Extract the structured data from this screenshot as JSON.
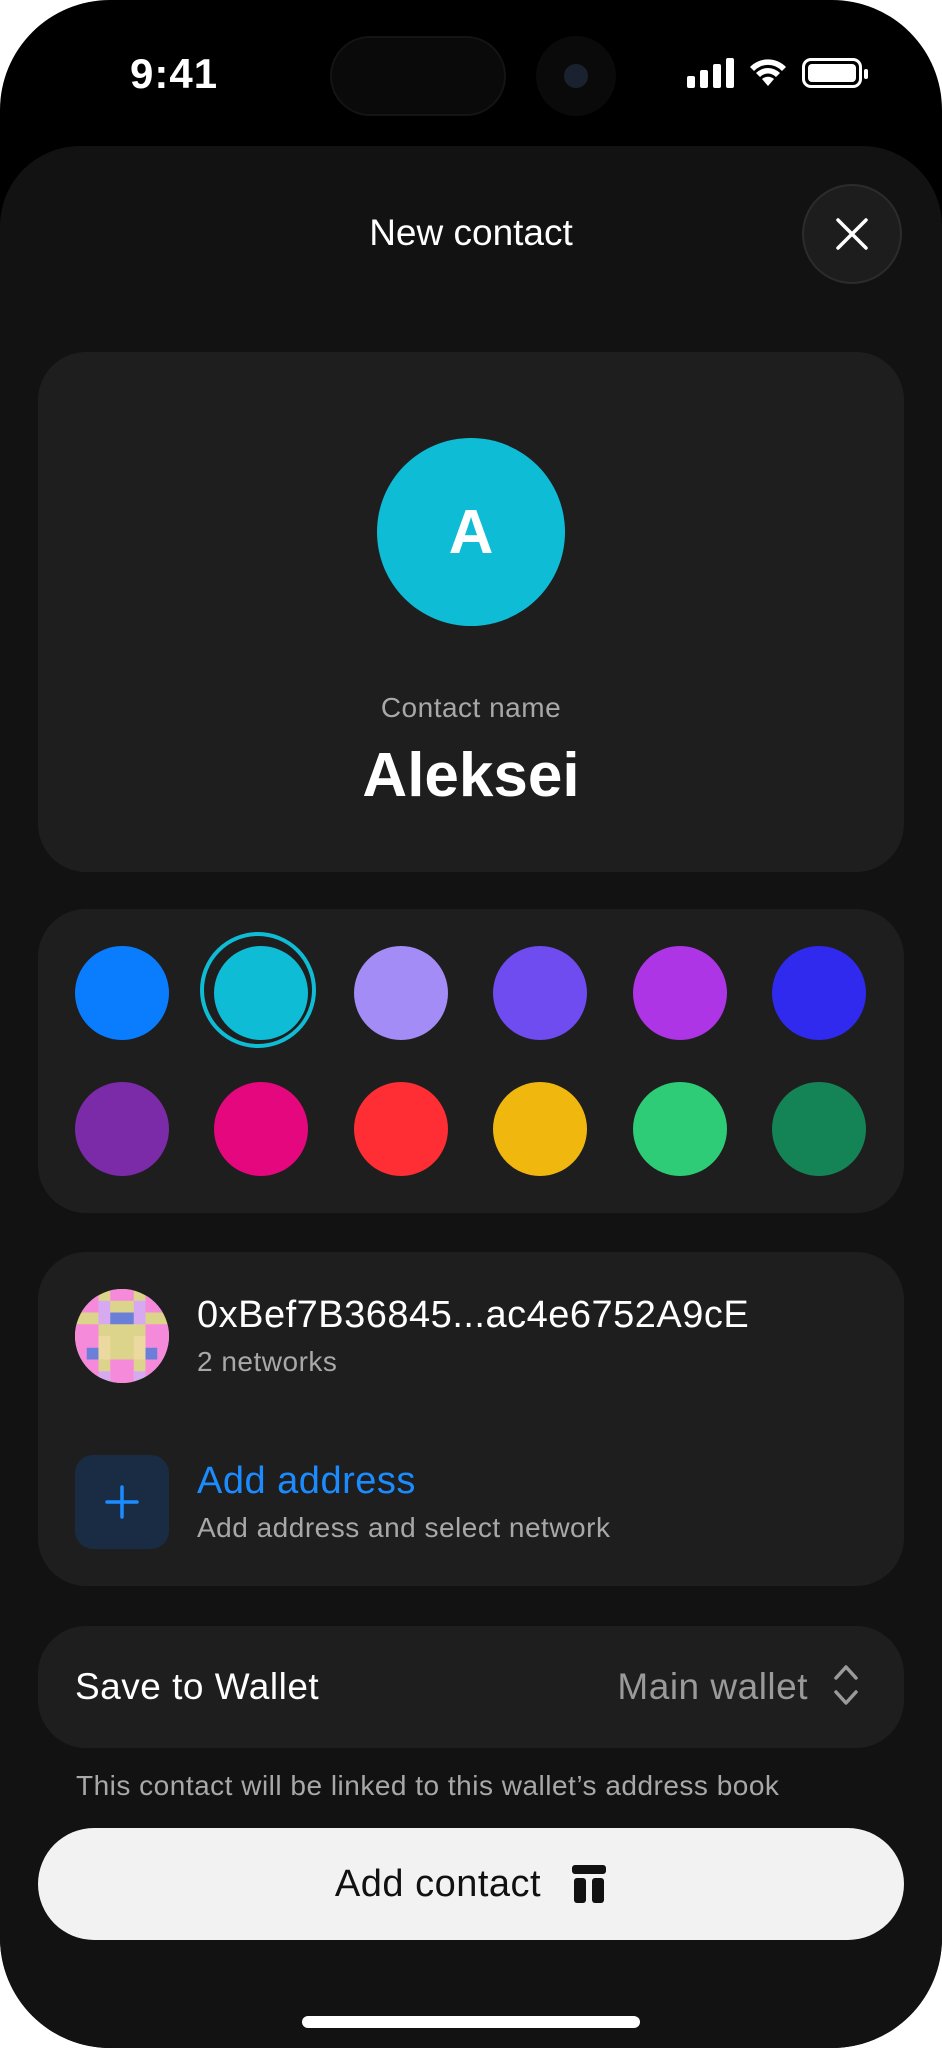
{
  "status_bar": {
    "time": "9:41"
  },
  "sheet": {
    "title": "New contact"
  },
  "profile": {
    "avatar_initial": "A",
    "avatar_color": "#0fbcd6",
    "name_label": "Contact name",
    "name_value": "Aleksei"
  },
  "color_picker": {
    "selected_index": 1,
    "colors": [
      "#0a7dff",
      "#0fbcd6",
      "#a38cf5",
      "#6e4cf0",
      "#ad35e6",
      "#3029ee",
      "#7b2aa8",
      "#e4077e",
      "#ff2e34",
      "#f0b70f",
      "#2fcc77",
      "#148457"
    ]
  },
  "addresses": [
    {
      "address": "0xBef7B36845...ac4e6752A9cE",
      "networks": "2 networks"
    }
  ],
  "add_address": {
    "title": "Add address",
    "subtitle": "Add address and select network"
  },
  "wallet": {
    "label": "Save to Wallet",
    "value": "Main wallet",
    "hint": "This contact will be linked to this wallet’s address book"
  },
  "primary_button": {
    "label": "Add contact"
  },
  "accent_color": "#1a8cff",
  "icons": {
    "close": "close-icon",
    "add": "plus-icon",
    "wallet_select": "chevron-up-down-icon",
    "button": "table-icon"
  }
}
